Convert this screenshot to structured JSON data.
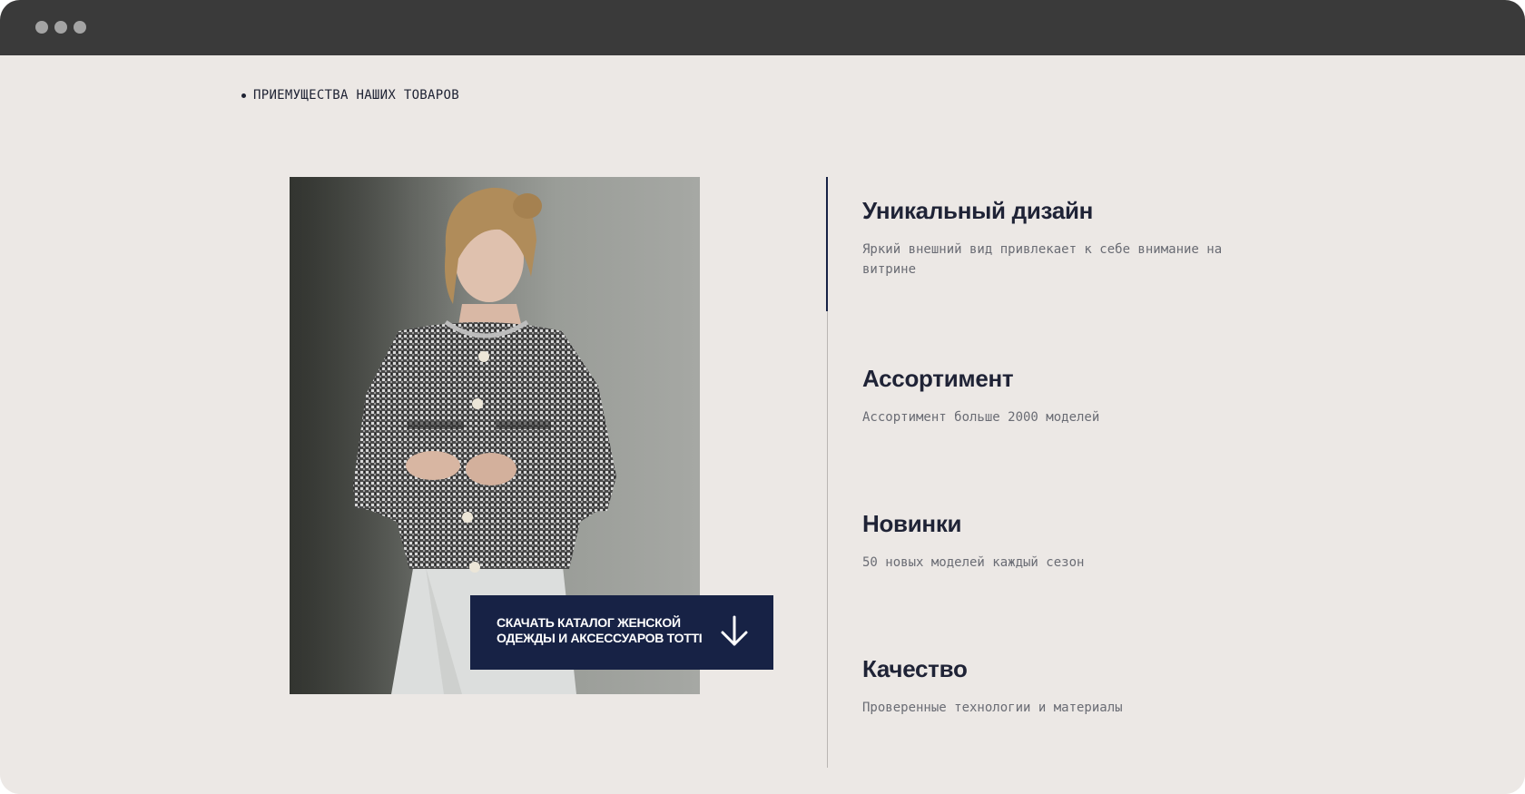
{
  "window": {
    "controls": [
      "window-dot-1",
      "window-dot-2",
      "window-dot-3"
    ]
  },
  "section": {
    "label": "ПРИЕМУЩЕСТВА НАШИХ ТОВАРОВ"
  },
  "cta": {
    "line1": "СКАЧАТЬ КАТАЛОГ ЖЕНСКОЙ",
    "line2": "ОДЕЖДЫ И АКСЕССУАРОВ TOTTI",
    "icon": "arrow-down-icon"
  },
  "features": [
    {
      "title": "Уникальный дизайн",
      "description": "Яркий внешний вид привлекает к себе внимание на витрине"
    },
    {
      "title": "Ассортимент",
      "description": "Ассортимент больше 2000 моделей"
    },
    {
      "title": "Новинки",
      "description": "50 новых моделей каждый сезон"
    },
    {
      "title": "Качество",
      "description": "Проверенные технологии и материалы"
    }
  ],
  "colors": {
    "background": "#ece8e5",
    "titlebar": "#3a3a3a",
    "accent": "#172245",
    "text": "#1f2336",
    "muted": "#6a6c74"
  }
}
